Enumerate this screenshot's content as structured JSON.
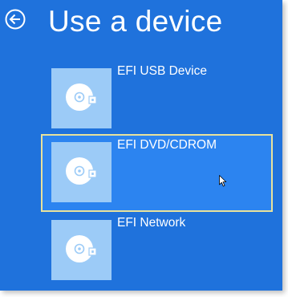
{
  "screen": {
    "title": "Use a device",
    "back_icon": "back-arrow-circle-icon",
    "colors": {
      "background": "#1f72dc",
      "tile": "#9ccbf7",
      "selection_fill": "#2c84f0",
      "selection_border": "#e8e29c",
      "text": "#ffffff"
    }
  },
  "devices": [
    {
      "label": "EFI USB Device",
      "icon": "disc-drive-icon",
      "selected": false
    },
    {
      "label": "EFI DVD/CDROM",
      "icon": "disc-drive-icon",
      "selected": true
    },
    {
      "label": "EFI Network",
      "icon": "disc-drive-icon",
      "selected": false
    }
  ]
}
